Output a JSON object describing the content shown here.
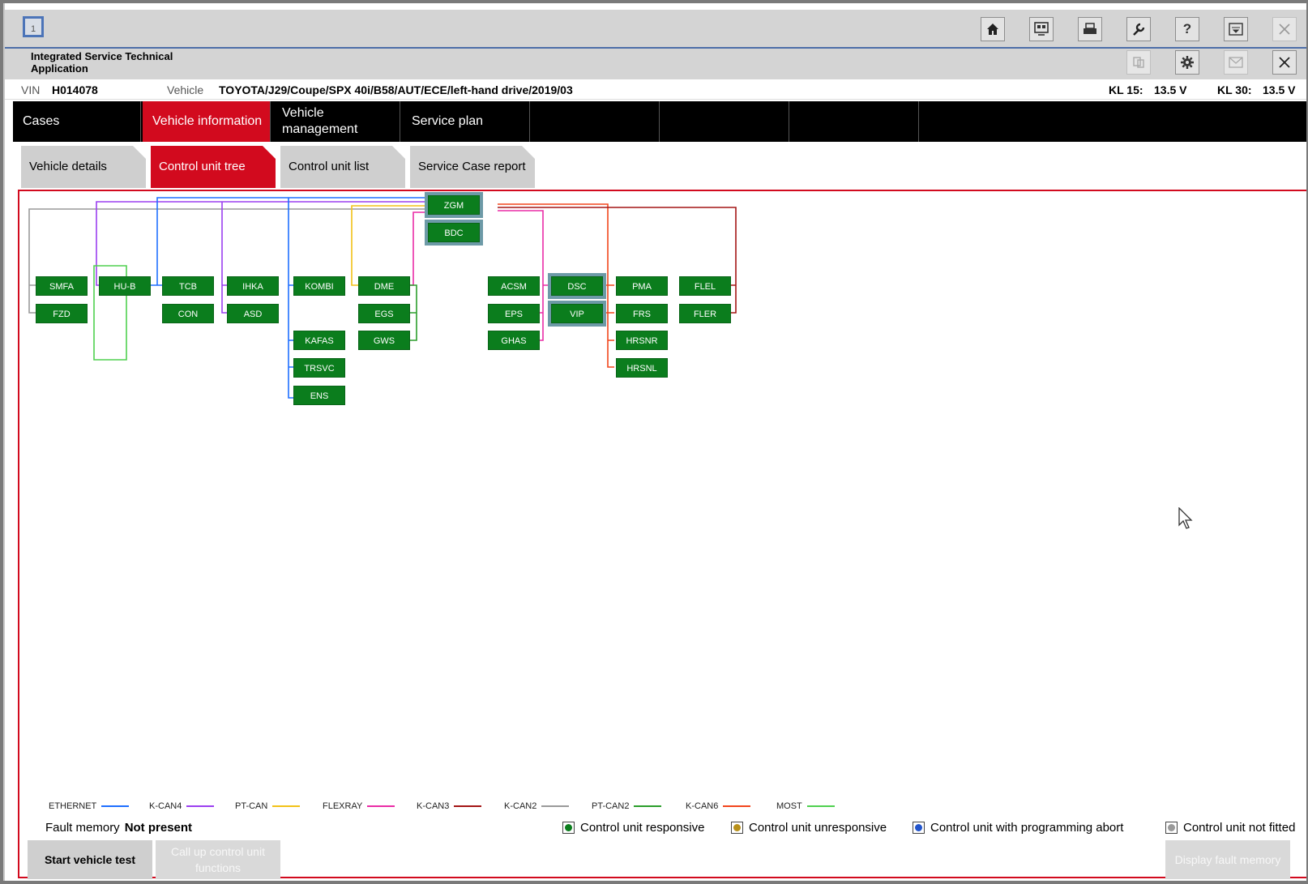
{
  "window": {
    "number": "1"
  },
  "toolbar": {
    "icons": [
      "home-icon",
      "diagnosis-icon",
      "print-icon",
      "wrench-icon",
      "help-icon",
      "minimize-icon",
      "close-icon"
    ],
    "help_glyph": "?"
  },
  "titlebar": {
    "app_name": "Integrated Service Technical Application",
    "icons": [
      "connection-icon",
      "settings-icon",
      "mail-icon",
      "close-icon"
    ]
  },
  "vehicle_bar": {
    "vin_label": "VIN",
    "vin_value": "H014078",
    "vehicle_label": "Vehicle",
    "vehicle_value": "TOYOTA/J29/Coupe/SPX 40i/B58/AUT/ECE/left-hand drive/2019/03",
    "kl15_label": "KL 15:",
    "kl15_value": "13.5 V",
    "kl30_label": "KL 30:",
    "kl30_value": "13.5 V"
  },
  "main_tabs": [
    {
      "label": "Cases",
      "active": false
    },
    {
      "label": "Vehicle information",
      "active": true
    },
    {
      "label": "Vehicle management",
      "active": false
    },
    {
      "label": "Service plan",
      "active": false
    },
    {
      "label": "",
      "active": false
    },
    {
      "label": "",
      "active": false
    },
    {
      "label": "",
      "active": false
    }
  ],
  "sub_tabs": [
    {
      "label": "Vehicle details",
      "active": false
    },
    {
      "label": "Control unit tree",
      "active": true
    },
    {
      "label": "Control unit list",
      "active": false
    },
    {
      "label": "Service Case report",
      "active": false
    }
  ],
  "control_units": {
    "ZGM": "ZGM",
    "BDC": "BDC",
    "SMFA": "SMFA",
    "FZD": "FZD",
    "HU-B": "HU-B",
    "TCB": "TCB",
    "CON": "CON",
    "IHKA": "IHKA",
    "ASD": "ASD",
    "KOMBI": "KOMBI",
    "KAFAS": "KAFAS",
    "TRSVC": "TRSVC",
    "ENS": "ENS",
    "DME": "DME",
    "EGS": "EGS",
    "GWS": "GWS",
    "ACSM": "ACSM",
    "EPS": "EPS",
    "GHAS": "GHAS",
    "DSC": "DSC",
    "VIP": "VIP",
    "PMA": "PMA",
    "FRS": "FRS",
    "HRSNR": "HRSNR",
    "HRSNL": "HRSNL",
    "FLEL": "FLEL",
    "FLER": "FLER"
  },
  "bus_legend": [
    {
      "name": "ETHERNET",
      "color": "#1f6fff"
    },
    {
      "name": "K-CAN4",
      "color": "#9b3ff0"
    },
    {
      "name": "PT-CAN",
      "color": "#f2c218"
    },
    {
      "name": "FLEXRAY",
      "color": "#ea2ca6"
    },
    {
      "name": "K-CAN3",
      "color": "#a31515"
    },
    {
      "name": "K-CAN2",
      "color": "#9a9a9a"
    },
    {
      "name": "PT-CAN2",
      "color": "#2b9e2b"
    },
    {
      "name": "K-CAN6",
      "color": "#f2451c"
    },
    {
      "name": "MOST",
      "color": "#4fd04f"
    }
  ],
  "fault_memory": {
    "label": "Fault memory",
    "value": "Not present"
  },
  "status_legend": [
    {
      "label": "Control unit responsive",
      "color": "#0b7d1d"
    },
    {
      "label": "Control unit unresponsive",
      "color": "#b8901a"
    },
    {
      "label": "Control unit with programming abort",
      "color": "#2255cc"
    },
    {
      "label": "Control unit not fitted",
      "color": "#9a9a9a"
    }
  ],
  "buttons": {
    "start_vehicle_test": "Start vehicle test",
    "call_up_functions": "Call up control unit functions",
    "display_fault_memory": "Display fault memory"
  }
}
